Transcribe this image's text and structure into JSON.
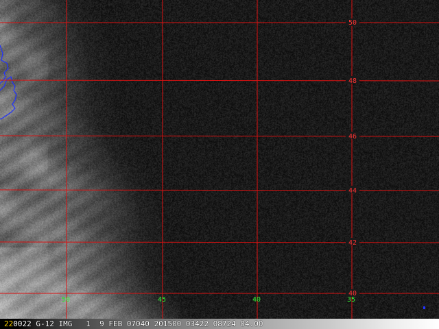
{
  "map": {
    "grid_color": "#dd1111",
    "lat_label_color": "#ff3333",
    "lon_label_color": "#33ee33",
    "coast_color": "#2233ff",
    "latitudes": [
      {
        "value": "50"
      },
      {
        "value": "48"
      },
      {
        "value": "46"
      },
      {
        "value": "44"
      },
      {
        "value": "42"
      },
      {
        "value": "40"
      }
    ],
    "longitudes": [
      {
        "value": "50"
      },
      {
        "value": "45"
      },
      {
        "value": "40"
      },
      {
        "value": "35"
      }
    ]
  },
  "status_bar": {
    "frame_number": "22",
    "text": "0022 G-12 IMG   1  9 FEB 07040 201500 03422 08724 04.00"
  }
}
